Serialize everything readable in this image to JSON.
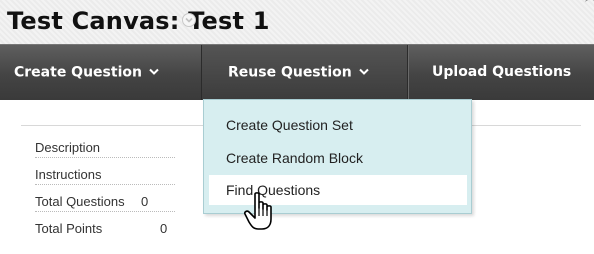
{
  "page": {
    "title": "Test Canvas: Test 1"
  },
  "action_bar": {
    "create_question": "Create Question",
    "reuse_question": "Reuse Question",
    "upload_questions": "Upload Questions"
  },
  "dropdown": {
    "items": [
      {
        "label": "Create Question Set"
      },
      {
        "label": "Create Random Block"
      },
      {
        "label": "Find Questions"
      }
    ],
    "active_index": 2
  },
  "info": {
    "description_label": "Description",
    "instructions_label": "Instructions",
    "total_questions_label": "Total Questions",
    "total_questions_value": "0",
    "total_points_label": "Total Points",
    "total_points_value": "0"
  },
  "icons": {
    "title_menu": "chevron-down-circle-icon",
    "caret": "chevron-down-icon",
    "cursor": "hand-pointer-cursor"
  },
  "colors": {
    "action_bar": "#444444",
    "dropdown_bg": "#d7eef0",
    "active_item_bg": "#ffffff"
  }
}
